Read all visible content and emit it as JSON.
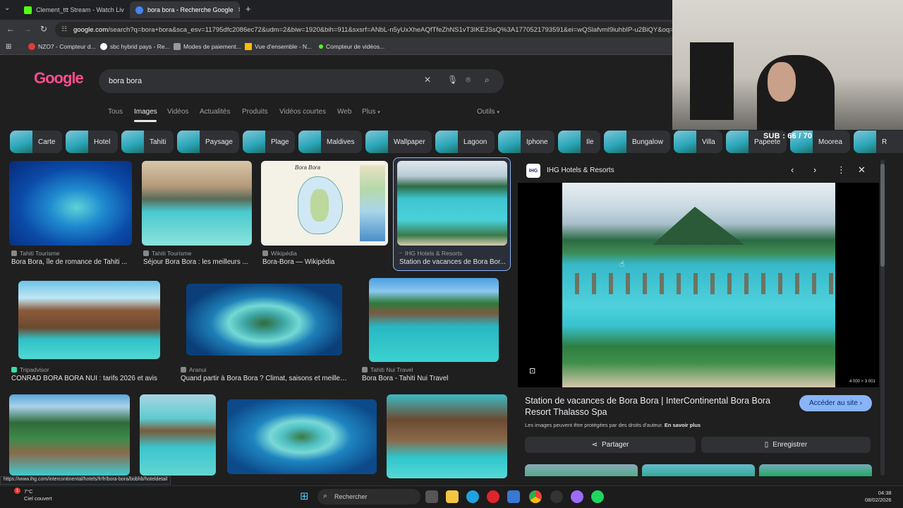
{
  "browser": {
    "tabs": [
      {
        "title": "Clement_ttt Stream - Watch Liv"
      },
      {
        "title": "bora bora - Recherche Google"
      }
    ],
    "url_host": "google.com",
    "url_rest": "/search?q=bora+bora&sca_esv=11795dfc2086ec72&udm=2&biw=1920&bih=911&sxsrf=ANbL-n5yUxXheAQfTfeZhNS1vT3IKEJSsQ%3A1770521793591&ei=wQSlafvmI9iuhbIP-u2BiQY&oq=bora",
    "bookmarks": [
      {
        "label": "NZO7 - Compteur d..."
      },
      {
        "label": "sbc hybrid pays - Re..."
      },
      {
        "label": "Modes de paiement..."
      },
      {
        "label": "Vue d'ensemble - N..."
      },
      {
        "label": "Compteur de vidéos..."
      }
    ]
  },
  "google": {
    "logo": "Google",
    "query": "bora bora",
    "tabs": [
      {
        "label": "Tous"
      },
      {
        "label": "Images"
      },
      {
        "label": "Vidéos"
      },
      {
        "label": "Actualités"
      },
      {
        "label": "Produits"
      },
      {
        "label": "Vidéos courtes"
      },
      {
        "label": "Web"
      },
      {
        "label": "Plus"
      }
    ],
    "tools_label": "Outils",
    "chips": [
      "Carte",
      "Hotel",
      "Tahiti",
      "Paysage",
      "Plage",
      "Maldives",
      "Wallpaper",
      "Lagoon",
      "Iphone",
      "Ile",
      "Bungalow",
      "Villa",
      "Papeete",
      "Moorea",
      "R"
    ]
  },
  "results": [
    {
      "source": "Tahiti Tourisme",
      "title": "Bora Bora, île de romance de Tahiti ..."
    },
    {
      "source": "Tahiti Tourisme",
      "title": "Séjour Bora Bora : les meilleurs ..."
    },
    {
      "source": "Wikipédia",
      "title": "Bora-Bora — Wikipédia"
    },
    {
      "source": "IHG Hotels & Resorts",
      "title": "Station de vacances de Bora Bor..."
    },
    {
      "source": "Tripadvisor",
      "title": "CONRAD BORA BORA NUI : tarifs 2026 et avis"
    },
    {
      "source": "Aranui",
      "title": "Quand partir à Bora Bora ? Climat, saisons et meilleu..."
    },
    {
      "source": "Tahiti Nui Travel",
      "title": "Bora Bora - Tahiti Nui Travel"
    }
  ],
  "map_label": "Bora Bora",
  "panel": {
    "source": "IHG Hotels & Resorts",
    "logo_text": "IHG",
    "dimensions": "4 000 × 3 001",
    "title": "Station de vacances de Bora Bora | InterContinental Bora Bora Resort Thalasso Spa",
    "visit_button": "Accéder au site",
    "copyright": "Les images peuvent être protégées par des droits d'auteur.",
    "learn_more": "En savoir plus",
    "share_button": "Partager",
    "save_button": "Enregistrer"
  },
  "overlay": {
    "sub_counter": "SUB : 66 / 70"
  },
  "status_url": "https://www.ihg.com/intercontinental/hotels/fr/fr/bora-bora/bobhb/hoteldetail",
  "taskbar": {
    "temperature": "7°C",
    "weather": "Ciel couvert",
    "notif_count": "1",
    "search_placeholder": "Rechercher",
    "time": "04:38",
    "date": "08/02/2026"
  },
  "colors": {
    "accent": "#8ab4f8",
    "background": "#1f1f1f"
  }
}
